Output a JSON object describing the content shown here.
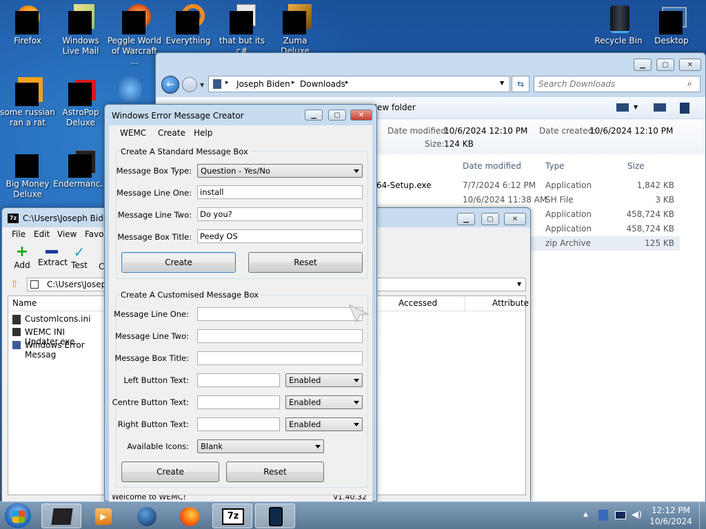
{
  "desktop": {
    "icons": [
      {
        "label": "Firefox"
      },
      {
        "label": "Windows Live Mail"
      },
      {
        "label": "Peggle World of Warcraft ..."
      },
      {
        "label": "Everything"
      },
      {
        "label": "that but its c#"
      },
      {
        "label": "Zuma Deluxe"
      },
      {
        "label": "Recycle Bin"
      },
      {
        "label": "Desktop"
      },
      {
        "label": "some russian ran a rat"
      },
      {
        "label": "AstroPop Deluxe"
      },
      {
        "label": "Big Money Deluxe"
      },
      {
        "label": "Endermanc..."
      }
    ]
  },
  "explorer": {
    "breadcrumb": [
      "Joseph Biden",
      "Downloads"
    ],
    "search_placeholder": "Search Downloads",
    "new_folder": "New folder",
    "details": {
      "date_modified_label": "Date modified:",
      "date_modified": "10/6/2024 12:10 PM",
      "date_created_label": "Date created:",
      "date_created": "10/6/2024 12:10 PM",
      "size_label": "Size:",
      "size": "124 KB"
    },
    "columns": [
      "Date modified",
      "Type",
      "Size"
    ],
    "rows": [
      {
        "name": "64-Setup.exe",
        "date": "7/7/2024 6:12 PM",
        "type": "Application",
        "size": "1,842 KB"
      },
      {
        "name": "",
        "date": "10/6/2024 11:38 AM",
        "type": "SH File",
        "size": "3 KB"
      },
      {
        "name": "",
        "date": "",
        "type": "Application",
        "size": "458,724 KB"
      },
      {
        "name": "",
        "date": "",
        "type": "Application",
        "size": "458,724 KB"
      },
      {
        "name": "",
        "date": "",
        "type": "zip Archive",
        "size": "125 KB"
      }
    ]
  },
  "sevenzip": {
    "title": "C:\\Users\\Joseph Biden",
    "menu": [
      "File",
      "Edit",
      "View",
      "Favor"
    ],
    "toolbar": [
      "Add",
      "Extract",
      "Test",
      "C"
    ],
    "path": "C:\\Users\\Joseph",
    "columns": {
      "name": "Name",
      "accessed": "Accessed",
      "attributes": "Attribute"
    },
    "files": [
      "CustomIcons.ini",
      "WEMC INI Updater.exe",
      "Windows Error Messag"
    ]
  },
  "wemc": {
    "title": "Windows Error Message Creator",
    "menu": [
      "WEMC",
      "Create",
      "Help"
    ],
    "standard": {
      "group_title": "Create A Standard Message Box",
      "type_label": "Message Box Type:",
      "type_value": "Question - Yes/No",
      "line1_label": "Message Line One:",
      "line1_value": "install",
      "line2_label": "Message Line Two:",
      "line2_value": "Do you?",
      "title_label": "Message Box Title:",
      "title_value": "Peedy OS",
      "create": "Create",
      "reset": "Reset"
    },
    "custom": {
      "group_title": "Create A Customised Message Box",
      "line1_label": "Message Line One:",
      "line2_label": "Message Line Two:",
      "title_label": "Message Box Title:",
      "left_label": "Left Button Text:",
      "centre_label": "Centre Button Text:",
      "right_label": "Right Button Text:",
      "left_state": "Enabled",
      "centre_state": "Enabled",
      "right_state": "Enabled",
      "icons_label": "Available Icons:",
      "icons_value": "Blank",
      "create": "Create",
      "reset": "Reset"
    },
    "status_left": "Welcome to WEMC!",
    "status_right": "v1.40.32"
  },
  "taskbar": {
    "time": "12:12 PM",
    "date": "10/6/2024"
  }
}
